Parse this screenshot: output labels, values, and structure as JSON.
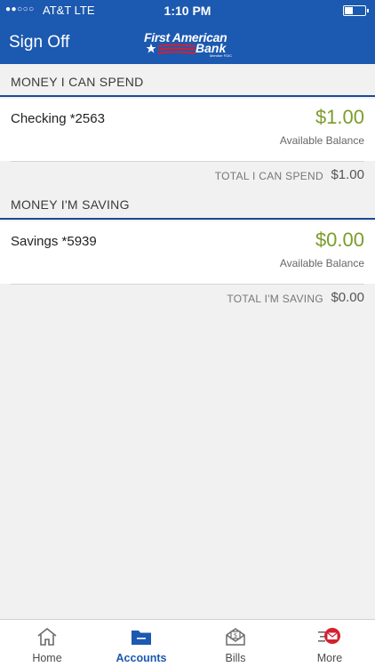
{
  "status": {
    "signal": "●●○○○",
    "carrier": "AT&T  LTE",
    "time": "1:10 PM"
  },
  "header": {
    "signoff_label": "Sign Off",
    "logo_line1": "First American",
    "logo_line2": "Bank",
    "logo_small": "Member FDIC"
  },
  "spend": {
    "heading": "MONEY I CAN SPEND",
    "account_name": "Checking *2563",
    "balance": "$1.00",
    "balance_label": "Available Balance",
    "total_label": "TOTAL I CAN SPEND",
    "total_value": "$1.00"
  },
  "saving": {
    "heading": "MONEY I'M SAVING",
    "account_name": "Savings *5939",
    "balance": "$0.00",
    "balance_label": "Available Balance",
    "total_label": "TOTAL I'M SAVING",
    "total_value": "$0.00"
  },
  "tabs": [
    {
      "label": "Home",
      "icon": "home-icon"
    },
    {
      "label": "Accounts",
      "icon": "folder-icon"
    },
    {
      "label": "Bills",
      "icon": "bills-envelope-icon"
    },
    {
      "label": "More",
      "icon": "mail-menu-icon"
    }
  ],
  "colors": {
    "brand_blue": "#1c59b0",
    "balance_green": "#7c9c2c",
    "section_rule": "#1e4797",
    "logo_red": "#d32030"
  }
}
